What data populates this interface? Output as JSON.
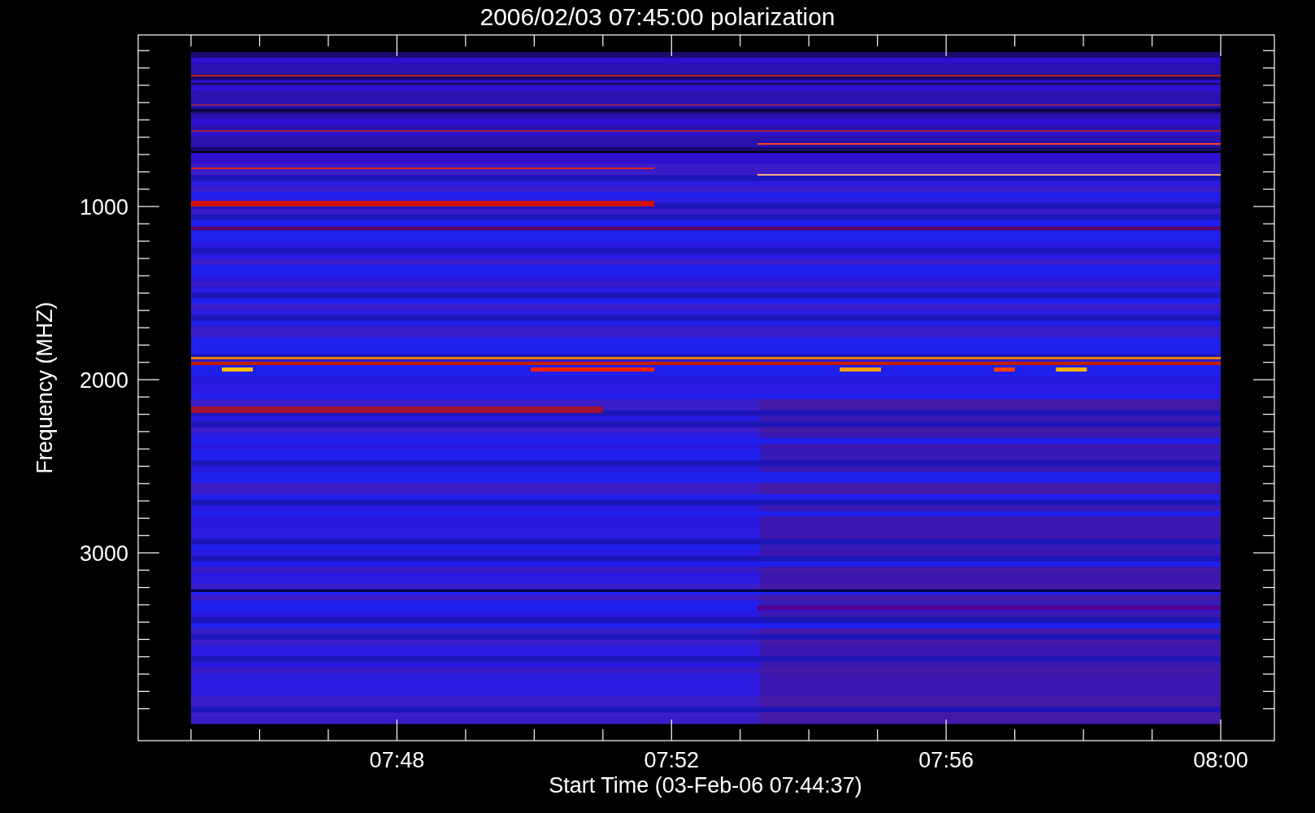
{
  "title": "2006/02/03 07:45:00 polarization",
  "y_axis": {
    "label": "Frequency (MHZ)",
    "ticks": [
      "1000",
      "2000",
      "3000"
    ]
  },
  "x_axis": {
    "label": "Start Time (03-Feb-06 07:44:37)",
    "ticks": [
      "07:48",
      "07:52",
      "07:56",
      "08:00"
    ]
  }
}
